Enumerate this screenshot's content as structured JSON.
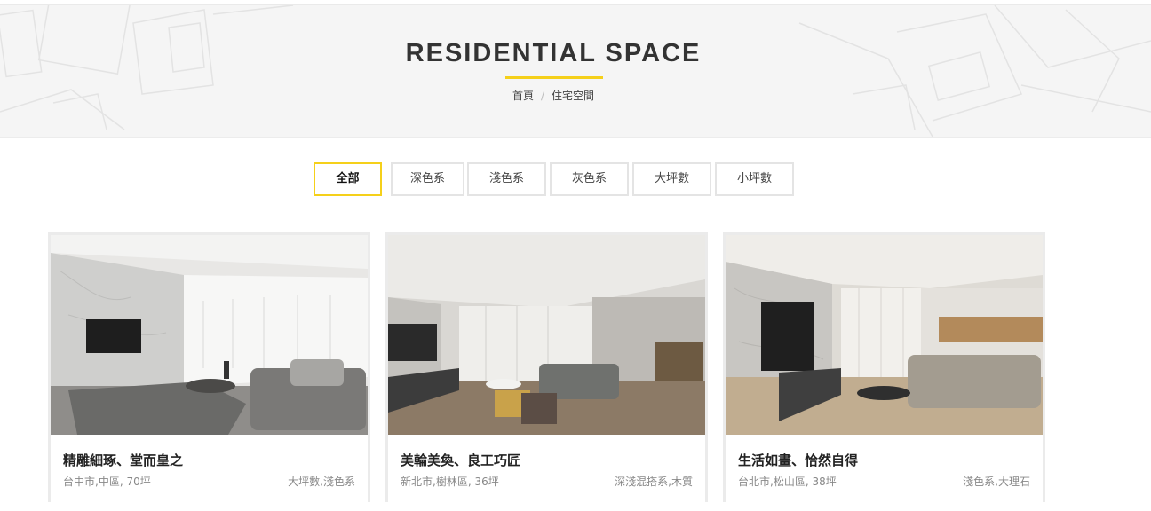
{
  "header": {
    "title": "RESIDENTIAL SPACE",
    "breadcrumb": {
      "home": "首頁",
      "separator": "/",
      "current": "住宅空間"
    }
  },
  "filters": [
    {
      "label": "全部",
      "active": true
    },
    {
      "label": "深色系",
      "active": false
    },
    {
      "label": "淺色系",
      "active": false
    },
    {
      "label": "灰色系",
      "active": false
    },
    {
      "label": "大坪數",
      "active": false
    },
    {
      "label": "小坪數",
      "active": false
    }
  ],
  "projects": [
    {
      "title": "精雕細琢、堂而皇之",
      "location": "台中市,中區, 70坪",
      "tags": "大坪數,淺色系",
      "image": "bright-living-room-marble-wall"
    },
    {
      "title": "美輪美奐、良工巧匠",
      "location": "新北市,樹林區, 36坪",
      "tags": "深淺混搭系,木質",
      "image": "grey-living-room-wood-floor"
    },
    {
      "title": "生活如畫、恰然自得",
      "location": "台北市,松山區, 38坪",
      "tags": "淺色系,大理石",
      "image": "beige-living-room-marble-tv-wall"
    }
  ],
  "colors": {
    "accent": "#f5d01a",
    "banner_bg": "#f5f5f5",
    "card_border": "#ebebeb",
    "text_dark": "#333333",
    "text_muted": "#888888"
  }
}
